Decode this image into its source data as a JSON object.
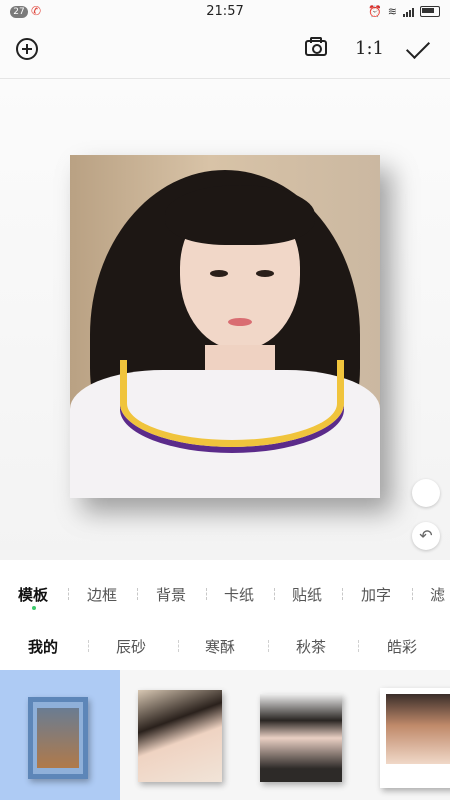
{
  "status_bar": {
    "badge": "27",
    "time": "21:57",
    "icons": [
      "missed-call-icon",
      "alarm-icon",
      "wifi-icon",
      "signal-icon",
      "battery-icon"
    ]
  },
  "toolbar": {
    "add_icon": "add-circle-icon",
    "camera_icon": "camera-icon",
    "ratio_label": "1:1",
    "confirm_icon": "checkmark-icon"
  },
  "canvas": {
    "photo": "portrait-photo",
    "side_buttons": [
      "circle-button",
      "undo-icon"
    ]
  },
  "category_tabs": [
    "模板",
    "边框",
    "背景",
    "卡纸",
    "贴纸",
    "加字",
    "滤"
  ],
  "active_category": "模板",
  "sub_tabs": [
    "我的",
    "辰砂",
    "寒酥",
    "秋茶",
    "皓彩"
  ],
  "active_sub_tab": "我的",
  "templates": [
    "template-1",
    "template-2",
    "template-3",
    "template-4"
  ],
  "colors": {
    "selected_template_bg": "#aecbf4",
    "active_dot": "#3cc96a",
    "missed_call": "#e0453b"
  }
}
